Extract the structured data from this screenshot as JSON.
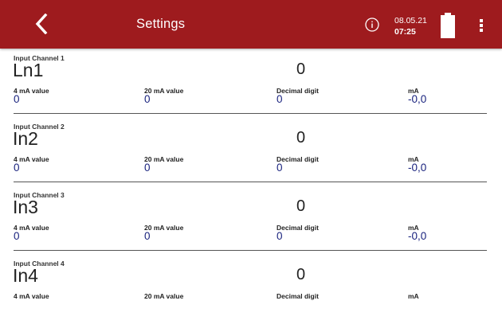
{
  "header": {
    "title": "Settings",
    "date": "08.05.21",
    "time": "07:25",
    "colors": {
      "bar": "#9e1b1e",
      "text": "#ffffff",
      "value": "#1a237e"
    },
    "icons": [
      "back-chevron-icon",
      "info-icon",
      "battery-icon",
      "more-vert-icon"
    ]
  },
  "fields": {
    "ma4": "4 mA value",
    "ma20": "20 mA value",
    "decimal": "Decimal digit",
    "ma": "mA"
  },
  "channels": [
    {
      "label": "Input Channel 1",
      "name": "Ln1",
      "reading": "0",
      "ma4": "0",
      "ma20": "0",
      "decimal": "0",
      "ma": "-0,0"
    },
    {
      "label": "Input Channel 2",
      "name": "In2",
      "reading": "0",
      "ma4": "0",
      "ma20": "0",
      "decimal": "0",
      "ma": "-0,0"
    },
    {
      "label": "Input Channel 3",
      "name": "In3",
      "reading": "0",
      "ma4": "0",
      "ma20": "0",
      "decimal": "0",
      "ma": "-0,0"
    },
    {
      "label": "Input Channel 4",
      "name": "In4",
      "reading": "0"
    }
  ]
}
